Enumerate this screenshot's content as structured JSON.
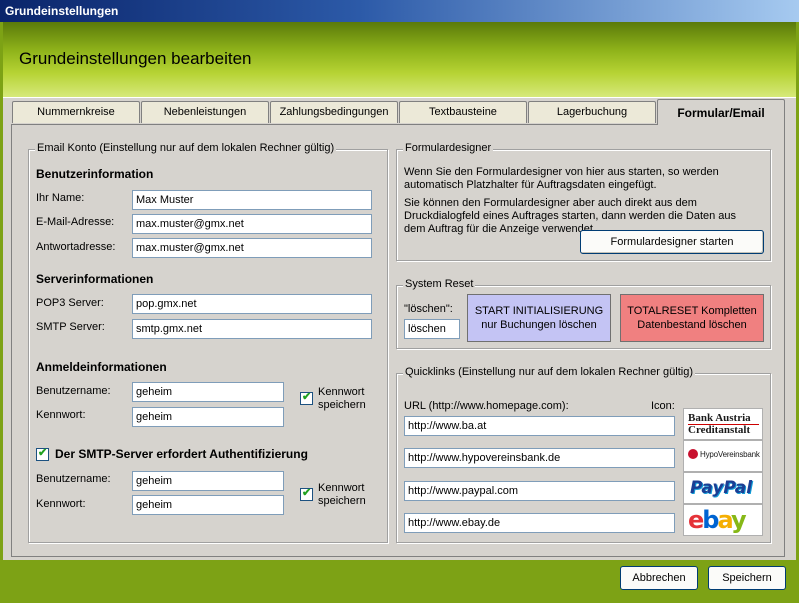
{
  "window": {
    "title": "Grundeinstellungen"
  },
  "header": {
    "title": "Grundeinstellungen bearbeiten"
  },
  "tabs": [
    {
      "label": "Nummernkreise",
      "active": false
    },
    {
      "label": "Nebenleistungen",
      "active": false
    },
    {
      "label": "Zahlungsbedingungen",
      "active": false
    },
    {
      "label": "Textbausteine",
      "active": false
    },
    {
      "label": "Lagerbuchung",
      "active": false
    },
    {
      "label": "Formular/Email",
      "active": true
    }
  ],
  "email": {
    "legend": "Email Konto (Einstellung nur auf dem lokalen Rechner gültig)",
    "user_heading": "Benutzerinformation",
    "name_label": "Ihr Name:",
    "name_value": "Max Muster",
    "email_label": "E-Mail-Adresse:",
    "email_value": "max.muster@gmx.net",
    "reply_label": "Antwortadresse:",
    "reply_value": "max.muster@gmx.net",
    "server_heading": "Serverinformationen",
    "pop3_label": "POP3 Server:",
    "pop3_value": "pop.gmx.net",
    "smtp_label": "SMTP Server:",
    "smtp_value": "smtp.gmx.net",
    "login_heading": "Anmeldeinformationen",
    "user_label": "Benutzername:",
    "user_value": "geheim",
    "pass_label": "Kennwort:",
    "pass_value": "geheim",
    "save_pw_line1": "Kennwort",
    "save_pw_line2": "speichern",
    "save_pw_checked": true,
    "smtp_auth_label": "Der SMTP-Server erfordert Authentifizierung",
    "smtp_auth_checked": true,
    "smtp_user_label": "Benutzername:",
    "smtp_user_value": "geheim",
    "smtp_pass_label": "Kennwort:",
    "smtp_pass_value": "geheim",
    "smtp_save_pw_line1": "Kennwort",
    "smtp_save_pw_line2": "speichern",
    "smtp_save_pw_checked": true
  },
  "formdesigner": {
    "legend": "Formulardesigner",
    "text1": "Wenn Sie den Formulardesigner von hier aus starten, so werden automatisch Platzhalter für Auftragsdaten eingefügt.",
    "text2": "Sie können den Formulardesigner aber auch direkt aus dem Druckdialogfeld eines Auftrages starten, dann werden die Daten aus dem Auftrag für die Anzeige verwendet.",
    "start_button": "Formulardesigner starten"
  },
  "reset": {
    "legend": "System Reset",
    "delete_label": "\"löschen\":",
    "delete_value": "löschen",
    "init_line1": "START INITIALISIERUNG",
    "init_line2": "nur Buchungen löschen",
    "init_color": "#c4c4f4",
    "total_line1": "TOTALRESET Kompletten",
    "total_line2": "Datenbestand löschen",
    "total_color": "#f08080"
  },
  "quicklinks": {
    "legend": "Quicklinks (Einstellung nur auf dem lokalen Rechner gültig)",
    "url_label": "URL (http://www.homepage.com):",
    "icon_label": "Icon:",
    "links": [
      {
        "url": "http://www.ba.at",
        "icon": "bank-austria-logo",
        "logo_line1": "Bank Austria",
        "logo_line2": "Creditanstalt"
      },
      {
        "url": "http://www.hypovereinsbank.de",
        "icon": "hypovereinsbank-logo",
        "logo_line1": "HypoVereinsbank"
      },
      {
        "url": "http://www.paypal.com",
        "icon": "paypal-logo",
        "logo_line1": "PayPal"
      },
      {
        "url": "http://www.ebay.de",
        "icon": "ebay-logo",
        "logo_line1": "ebay"
      }
    ]
  },
  "footer": {
    "cancel": "Abbrechen",
    "save": "Speichern"
  },
  "colors": {
    "frame_green": "#7da215",
    "panel_gray": "#d6d3ce",
    "title_blue": "#0a246a"
  }
}
